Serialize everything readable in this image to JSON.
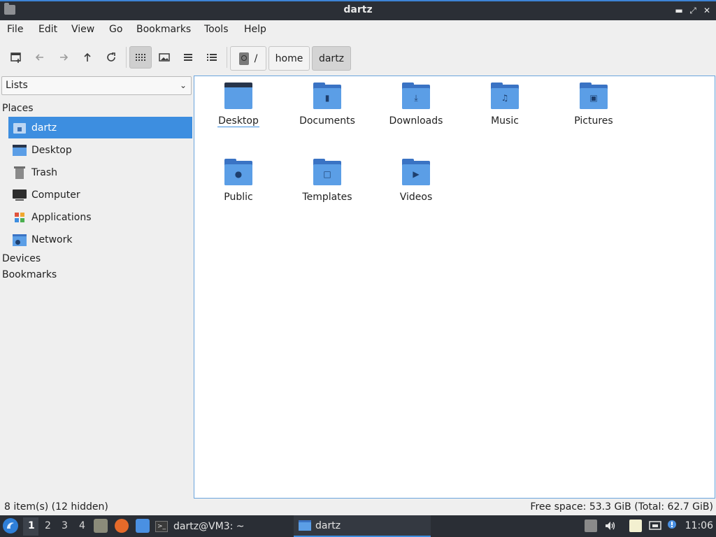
{
  "window": {
    "title": "dartz"
  },
  "menubar": {
    "items": [
      "File",
      "Edit",
      "View",
      "Go",
      "Bookmarks",
      "Tools",
      "Help"
    ]
  },
  "toolbar": {
    "new_tab_icon": "new-tab-icon",
    "back_icon": "arrow-left-icon",
    "forward_icon": "arrow-right-icon",
    "up_icon": "arrow-up-icon",
    "reload_icon": "reload-icon",
    "view_modes": [
      "icon-view",
      "thumbnail-view",
      "compact-view",
      "detailed-list-view"
    ],
    "active_view": "icon-view"
  },
  "breadcrumb": {
    "root": "/",
    "items": [
      "home",
      "dartz"
    ],
    "active": "dartz"
  },
  "sidebar": {
    "mode": "Lists",
    "places_label": "Places",
    "places": [
      "dartz",
      "Desktop",
      "Trash",
      "Computer",
      "Applications",
      "Network"
    ],
    "selected": "dartz",
    "devices_label": "Devices",
    "bookmarks_label": "Bookmarks"
  },
  "files": [
    "Desktop",
    "Documents",
    "Downloads",
    "Music",
    "Pictures",
    "Public",
    "Templates",
    "Videos"
  ],
  "status": {
    "items": "8 item(s) (12 hidden)",
    "free_space": "Free space: 53.3 GiB (Total: 62.7 GiB)"
  },
  "taskbar": {
    "workspaces": [
      "1",
      "2",
      "3",
      "4"
    ],
    "active_workspace": "1",
    "tasks": [
      "dartz@VM3: ~",
      "dartz"
    ],
    "active_task": "dartz",
    "clock": "11:06"
  },
  "colors": {
    "accent": "#3d8ee0",
    "folder_front": "#5b9ee6",
    "folder_back": "#3a73c4",
    "titlebar": "#2b2f36"
  }
}
